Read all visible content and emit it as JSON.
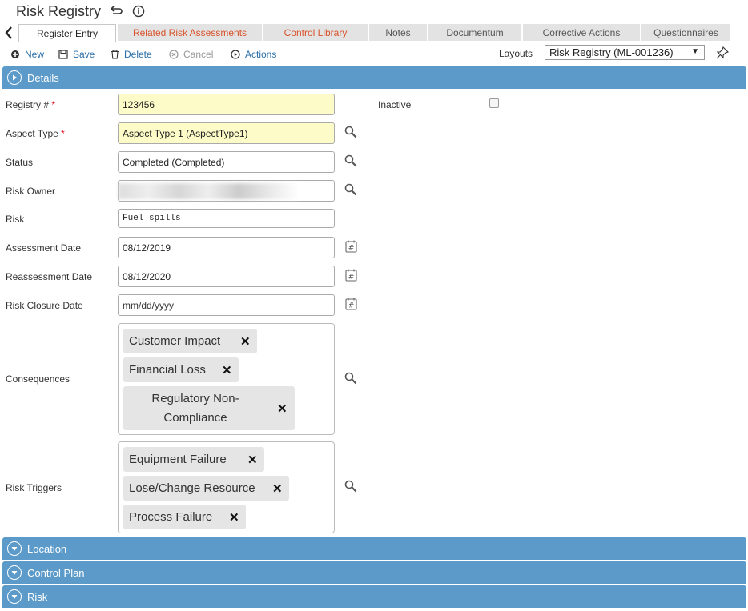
{
  "header": {
    "title": "Risk Registry"
  },
  "tabs": [
    {
      "label": "Register Entry"
    },
    {
      "label": "Related Risk Assessments"
    },
    {
      "label": "Control Library"
    },
    {
      "label": "Notes"
    },
    {
      "label": "Documentum"
    },
    {
      "label": "Corrective Actions"
    },
    {
      "label": "Questionnaires"
    }
  ],
  "toolbar": {
    "new_label": "New",
    "save_label": "Save",
    "delete_label": "Delete",
    "cancel_label": "Cancel",
    "actions_label": "Actions",
    "layouts_label": "Layouts",
    "layout_selected": "Risk Registry (ML-001236)"
  },
  "sections": {
    "details": "Details",
    "location": "Location",
    "control_plan": "Control Plan",
    "risk": "Risk"
  },
  "form": {
    "registry_label": "Registry #",
    "registry_value": "123456",
    "required_mark": "*",
    "inactive_label": "Inactive",
    "aspect_type_label": "Aspect Type",
    "aspect_type_value": "Aspect Type 1 (AspectType1)",
    "status_label": "Status",
    "status_value": "Completed (Completed)",
    "risk_owner_label": "Risk Owner",
    "risk_label": "Risk",
    "risk_value": "Fuel spills",
    "assessment_date_label": "Assessment Date",
    "assessment_date_value": "08/12/2019",
    "reassessment_date_label": "Reassessment Date",
    "reassessment_date_value": "08/12/2020",
    "risk_closure_date_label": "Risk Closure Date",
    "risk_closure_date_placeholder": "mm/dd/yyyy",
    "consequences_label": "Consequences",
    "consequences": [
      "Customer Impact",
      "Financial Loss",
      "Regulatory Non-Compliance"
    ],
    "risk_triggers_label": "Risk Triggers",
    "risk_triggers": [
      "Equipment Failure",
      "Lose/Change Resource",
      "Process Failure"
    ]
  },
  "colors": {
    "section_bar": "#5b9ac9",
    "link_blue": "#2a6fa8",
    "tab_red": "#d9532b",
    "required_yellow": "#fdfbc8"
  }
}
